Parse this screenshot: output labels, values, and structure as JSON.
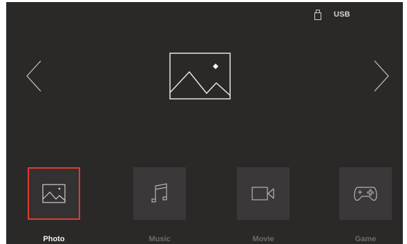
{
  "status_bar": {
    "usb_label": "USB",
    "usb_icon": "usb-drive-icon"
  },
  "navigation": {
    "prev_icon": "chevron-left-icon",
    "next_icon": "chevron-right-icon"
  },
  "preview": {
    "icon": "image-placeholder-icon"
  },
  "tiles": [
    {
      "label": "Photo",
      "icon": "photo-icon",
      "selected": true
    },
    {
      "label": "Music",
      "icon": "music-note-icon",
      "selected": false
    },
    {
      "label": "Movie",
      "icon": "video-camera-icon",
      "selected": false
    },
    {
      "label": "Game",
      "icon": "gamepad-icon",
      "selected": false
    }
  ],
  "colors": {
    "background": "#2b2928",
    "tile": "#3a3838",
    "selection_border": "#e23a2f",
    "label_active": "#f2f2f2",
    "label_inactive": "#6d6b6a"
  }
}
